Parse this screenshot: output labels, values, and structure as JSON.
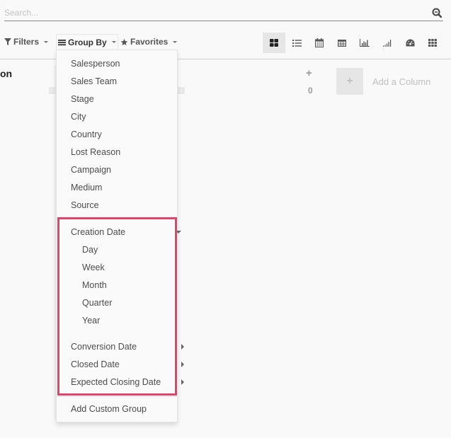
{
  "search": {
    "placeholder": "Search...",
    "value": ""
  },
  "toolbar": {
    "filters_label": "Filters",
    "groupby_label": "Group By",
    "favorites_label": "Favorites"
  },
  "views": [
    {
      "name": "kanban",
      "icon": "kanban-icon",
      "active": true
    },
    {
      "name": "list",
      "icon": "list-icon",
      "active": false
    },
    {
      "name": "calendar",
      "icon": "calendar-icon",
      "active": false
    },
    {
      "name": "pivot",
      "icon": "pivot-table-icon",
      "active": false
    },
    {
      "name": "graph",
      "icon": "bar-chart-icon",
      "active": false
    },
    {
      "name": "cohort",
      "icon": "signal-icon",
      "active": false
    },
    {
      "name": "dashboard",
      "icon": "dashboard-icon",
      "active": false
    },
    {
      "name": "activity",
      "icon": "grid-icon",
      "active": false
    }
  ],
  "kanban": {
    "column_title_partial": "on",
    "column_count": "0",
    "add_column_label": "Add a Column"
  },
  "groupby_menu": {
    "fields": [
      "Salesperson",
      "Sales Team",
      "Stage",
      "City",
      "Country",
      "Lost Reason",
      "Campaign",
      "Medium",
      "Source"
    ],
    "date_fields": [
      {
        "label": "Creation Date",
        "expanded": true,
        "options": [
          "Day",
          "Week",
          "Month",
          "Quarter",
          "Year"
        ]
      },
      {
        "label": "Conversion Date",
        "expanded": false
      },
      {
        "label": "Closed Date",
        "expanded": false
      },
      {
        "label": "Expected Closing Date",
        "expanded": false
      }
    ],
    "add_custom_group_label": "Add Custom Group"
  },
  "colors": {
    "highlight": "#e0436b",
    "active_view_bg": "#e6e6e6"
  }
}
